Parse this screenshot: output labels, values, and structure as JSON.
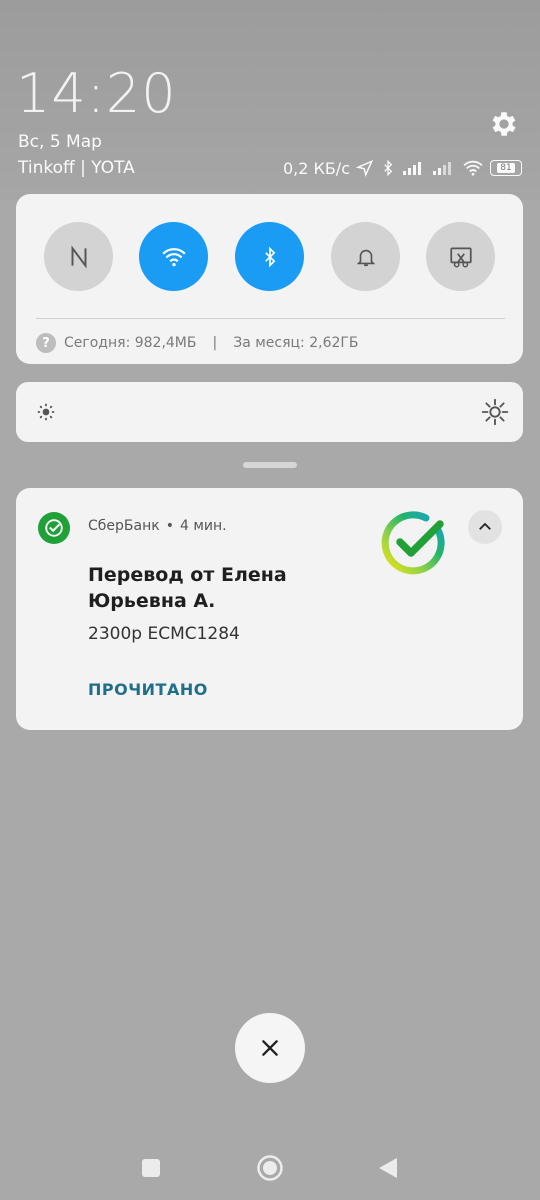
{
  "status_bar": {
    "time": "14:20",
    "date": "Вс, 5 Мар",
    "carrier": "Tinkoff | YOTA",
    "speed": "0,2 КБ/с",
    "battery": "81"
  },
  "quick_settings": {
    "tiles": [
      {
        "id": "nfc",
        "active": false
      },
      {
        "id": "wifi",
        "active": true
      },
      {
        "id": "bluetooth",
        "active": true
      },
      {
        "id": "sound",
        "active": false
      },
      {
        "id": "screenshot",
        "active": false
      }
    ],
    "usage_today": "Сегодня: 982,4МБ",
    "separator": "|",
    "usage_month": "За месяц: 2,62ГБ"
  },
  "notification": {
    "app_name": "СберБанк",
    "dot": "•",
    "time_ago": "4 мин.",
    "title": "Перевод от Елена Юрьевна А.",
    "body": "2300р ECMC1284",
    "action": "ПРОЧИТАНО"
  },
  "colors": {
    "accent": "#1a9cf4",
    "sber_green": "#21a038",
    "action_text": "#1f6e8c"
  }
}
